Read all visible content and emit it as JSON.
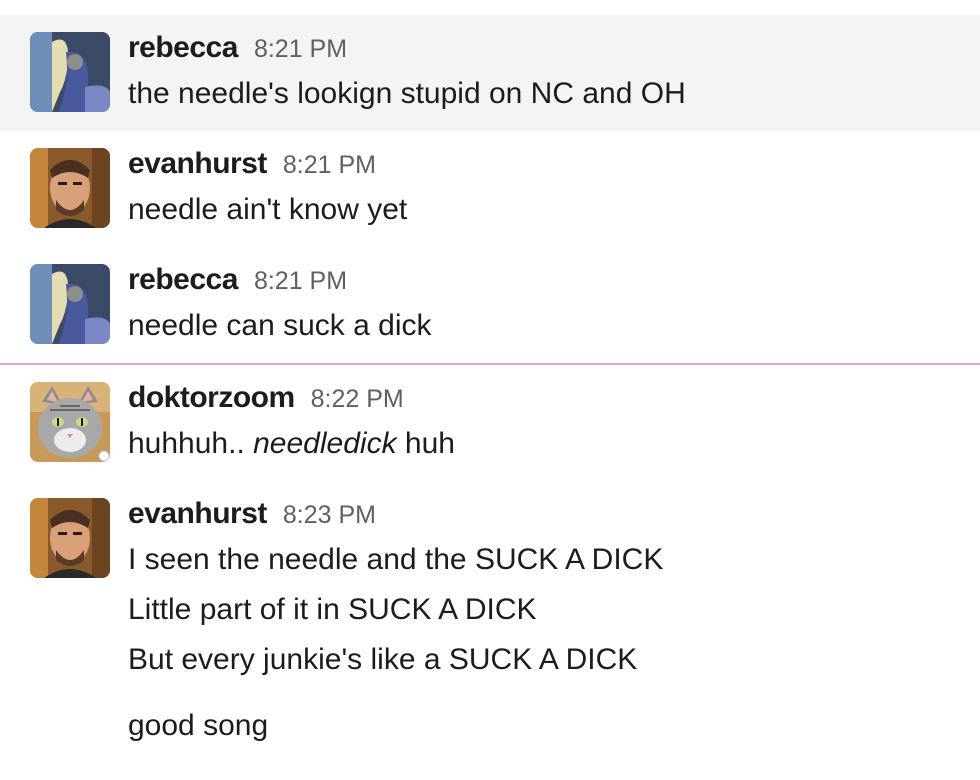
{
  "messages": [
    {
      "user": "rebecca",
      "time": "8:21 PM",
      "avatar_icon": "rebecca-avatar-icon",
      "highlighted": true,
      "lines": [
        "the needle's lookign stupid on NC and OH"
      ]
    },
    {
      "user": "evanhurst",
      "time": "8:21 PM",
      "avatar_icon": "evanhurst-avatar-icon",
      "lines": [
        "needle ain't know yet"
      ]
    },
    {
      "user": "rebecca",
      "time": "8:21 PM",
      "avatar_icon": "rebecca-avatar-icon",
      "lines": [
        "needle can suck a dick"
      ]
    },
    {
      "user": "doktorzoom",
      "time": "8:22 PM",
      "avatar_icon": "cat-avatar-icon",
      "line_prefix": "huhhuh.. ",
      "line_italic": "needledick",
      "line_suffix": " huh"
    },
    {
      "user": "evanhurst",
      "time": "8:23 PM",
      "avatar_icon": "evanhurst-avatar-icon",
      "lines": [
        "I seen the needle and the SUCK A DICK",
        "Little part of it in SUCK A DICK",
        "But every junkie's like a SUCK A DICK"
      ],
      "followup": "good song"
    }
  ],
  "colors": {
    "new_messages_divider": "#e8a4c8",
    "highlight_background": "#f4f4f4",
    "timestamp": "#616061"
  }
}
